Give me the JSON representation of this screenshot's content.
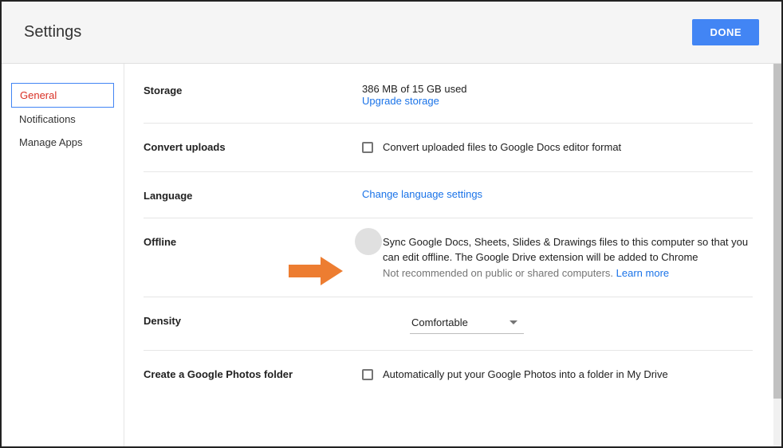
{
  "header": {
    "title": "Settings",
    "done": "DONE"
  },
  "sidebar": {
    "items": [
      {
        "label": "General",
        "active": true
      },
      {
        "label": "Notifications",
        "active": false
      },
      {
        "label": "Manage Apps",
        "active": false
      }
    ]
  },
  "settings": {
    "storage": {
      "label": "Storage",
      "usage": "386 MB of 15 GB used",
      "upgrade": "Upgrade storage"
    },
    "convert": {
      "label": "Convert uploads",
      "text": "Convert uploaded files to Google Docs editor format"
    },
    "language": {
      "label": "Language",
      "link": "Change language settings"
    },
    "offline": {
      "label": "Offline",
      "text": "Sync Google Docs, Sheets, Slides & Drawings files to this computer so that you can edit offline. The Google Drive extension will be added to Chrome",
      "note": "Not recommended on public or shared computers. ",
      "learn": "Learn more"
    },
    "density": {
      "label": "Density",
      "value": "Comfortable"
    },
    "photos": {
      "label": "Create a Google Photos folder",
      "text": "Automatically put your Google Photos into a folder in My Drive"
    }
  }
}
